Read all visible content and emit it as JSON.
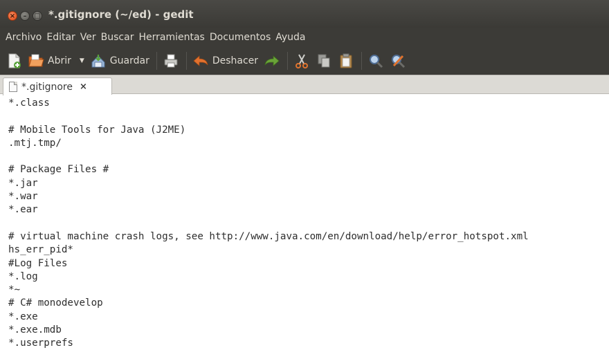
{
  "window": {
    "title": "*.gitignore (~/ed) - gedit"
  },
  "menubar": {
    "items": [
      "Archivo",
      "Editar",
      "Ver",
      "Buscar",
      "Herramientas",
      "Documentos",
      "Ayuda"
    ]
  },
  "toolbar": {
    "open_label": "Abrir",
    "save_label": "Guardar",
    "undo_label": "Deshacer",
    "icons": [
      "new-document-icon",
      "open-folder-icon",
      "save-icon",
      "print-icon",
      "undo-icon",
      "redo-icon",
      "cut-icon",
      "copy-icon",
      "paste-icon",
      "search-icon",
      "replace-icon"
    ]
  },
  "tabs": [
    {
      "label": "*.gitignore",
      "close": "×"
    }
  ],
  "editor": {
    "lines": [
      "*.class",
      "",
      "# Mobile Tools for Java (J2ME)",
      ".mtj.tmp/",
      "",
      "# Package Files #",
      "*.jar",
      "*.war",
      "*.ear",
      "",
      "# virtual machine crash logs, see http://www.java.com/en/download/help/error_hotspot.xml",
      "hs_err_pid*",
      "#Log Files",
      "*.log",
      "*~",
      "# C# monodevelop",
      "*.exe",
      "*.exe.mdb",
      "*.userprefs"
    ]
  },
  "colors": {
    "chrome_dark": "#3c3b37",
    "chrome_text": "#dfdbd2",
    "close_button": "#df4a16",
    "tabstrip": "#dcdad5"
  }
}
